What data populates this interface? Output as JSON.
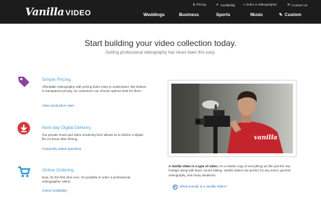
{
  "header": {
    "logo_script": "Vanilla",
    "logo_word": "VIDEO",
    "utility": [
      {
        "label": "Pricing",
        "icon": "dollar-icon"
      },
      {
        "label": "Availability",
        "icon": "check-circle-icon"
      },
      {
        "label": "Order a Videographer",
        "icon": "cart-icon"
      },
      {
        "label": "Contact Us",
        "icon": "envelope-icon"
      }
    ],
    "nav": [
      "Weddings",
      "Business",
      "Sports",
      "Music",
      "Custom"
    ],
    "nav_custom_icon": "pencil-icon"
  },
  "hero": {
    "headline": "Start building your video collection today.",
    "subline": "Getting professional videography has never been this easy."
  },
  "features": [
    {
      "title": "Simple Pricing.",
      "text": "Affordable videography with pricing that's easy to understand. We believe in transparent pricing, so customers can choose options best for them.",
      "link": "Video production rates",
      "icon": "price-tag-icon",
      "color": "#8e3fa0"
    },
    {
      "title": "Next-day Digital Delivery.",
      "text": "Our private cloud and video rendering farm allows us to deliver a digital file 24-hours after filming.",
      "link": "Frequently asked questions",
      "icon": "cloud-download-icon",
      "color": "#d33a3a"
    },
    {
      "title": "Online Ordering.",
      "text": "Now, for the first time ever, it's possible to order a professional videographer online.",
      "link": "Check Availability",
      "icon": "shopping-cart-icon",
      "color": "#2e9ad6"
    }
  ],
  "photo": {
    "alt": "videographer-with-camera",
    "shirt_text": "vanilla"
  },
  "caption": {
    "lead": "A Vanilla Video is a type of video.",
    "text": " It's a master copy of everything we film just the raw footage along with basic sound editing. Vanilla Videos are perfect for any event, general videography, and many situations."
  },
  "video_link": "What exactly is a Vanilla Video?",
  "colors": {
    "header_bg": "#1c1c1c",
    "link": "#2a72b8",
    "feature_title": "#4aa3d8",
    "shirt": "#c4252d"
  }
}
